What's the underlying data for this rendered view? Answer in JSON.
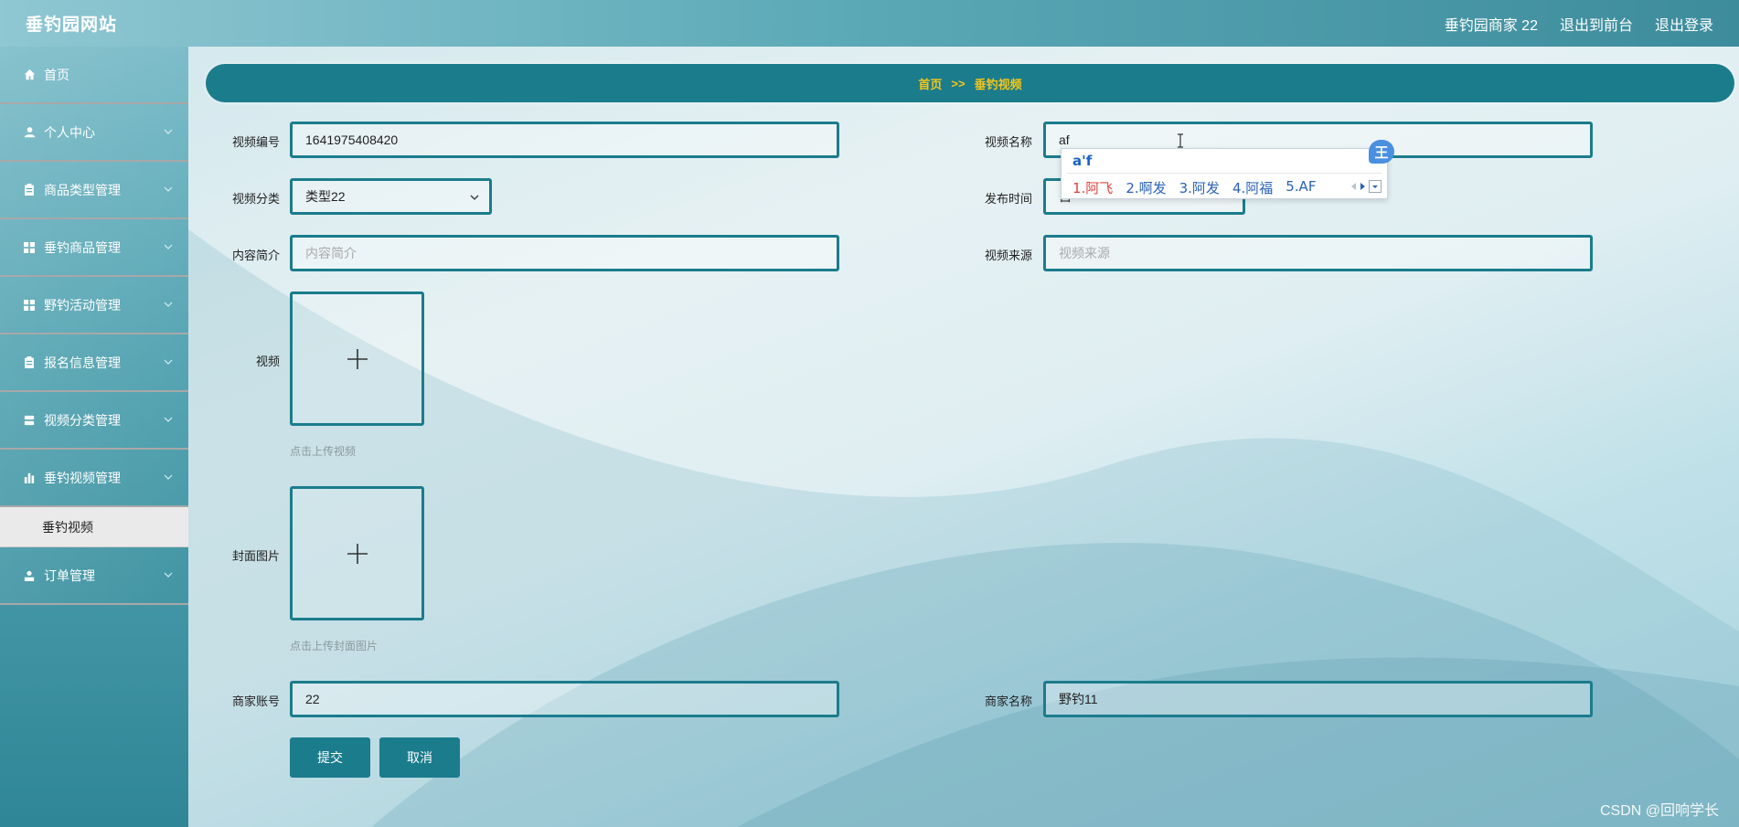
{
  "header": {
    "brand": "垂钓园网站",
    "user": "垂钓园商家 22",
    "to_front": "退出到前台",
    "logout": "退出登录"
  },
  "sidebar": {
    "items": [
      {
        "label": "首页",
        "icon": "home-icon"
      },
      {
        "label": "个人中心",
        "icon": "user-icon"
      },
      {
        "label": "商品类型管理",
        "icon": "clipboard-icon"
      },
      {
        "label": "垂钓商品管理",
        "icon": "grid-icon"
      },
      {
        "label": "野钓活动管理",
        "icon": "grid-icon"
      },
      {
        "label": "报名信息管理",
        "icon": "clipboard-icon"
      },
      {
        "label": "视频分类管理",
        "icon": "stack-icon"
      },
      {
        "label": "垂钓视频管理",
        "icon": "bar-chart-icon"
      },
      {
        "label": "订单管理",
        "icon": "person-icon"
      }
    ],
    "sub_item": "垂钓视频"
  },
  "breadcrumb": {
    "home": "首页",
    "sep": ">>",
    "current": "垂钓视频"
  },
  "form": {
    "video_no": {
      "label": "视频编号",
      "value": "1641975408420"
    },
    "video_name": {
      "label": "视频名称",
      "value": "af"
    },
    "category": {
      "label": "视频分类",
      "value": "类型22"
    },
    "publish_time": {
      "label": "发布时间",
      "value": "自"
    },
    "intro": {
      "label": "内容简介",
      "placeholder": "内容简介"
    },
    "source": {
      "label": "视频来源",
      "placeholder": "视频来源"
    },
    "video": {
      "label": "视频",
      "hint": "点击上传视频"
    },
    "cover": {
      "label": "封面图片",
      "hint": "点击上传封面图片"
    },
    "merchant_account": {
      "label": "商家账号",
      "value": "22"
    },
    "merchant_name": {
      "label": "商家名称",
      "value": "野钓11"
    },
    "submit": "提交",
    "cancel": "取消"
  },
  "ime": {
    "composition": "a'f",
    "candidates": [
      "1.阿飞",
      "2.啊发",
      "3.阿发",
      "4.阿福",
      "5.AF"
    ],
    "badge": "王"
  },
  "watermark": "CSDN @回响学长"
}
